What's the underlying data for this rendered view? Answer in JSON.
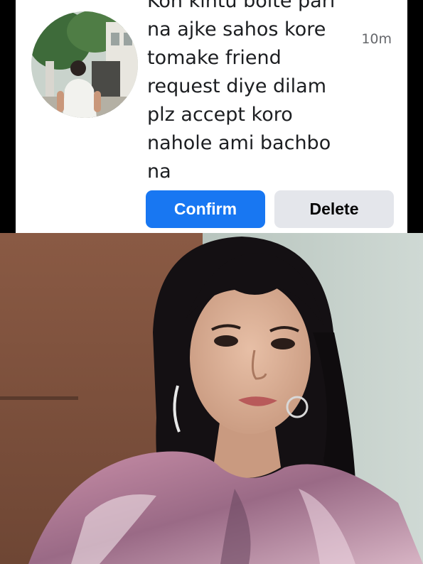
{
  "notification": {
    "message_lines": [
      "Kon kintu bolte pari",
      "na ajke sahos kore",
      "tomake friend",
      "request diye dilam",
      "plz accept koro",
      "nahole ami bachbo",
      "na"
    ],
    "timestamp": "10m",
    "confirm_label": "Confirm",
    "delete_label": "Delete"
  },
  "colors": {
    "confirm_bg": "#1877f2",
    "delete_bg": "#e4e6eb",
    "text_primary": "#1c1e21",
    "text_secondary": "#65676b"
  }
}
